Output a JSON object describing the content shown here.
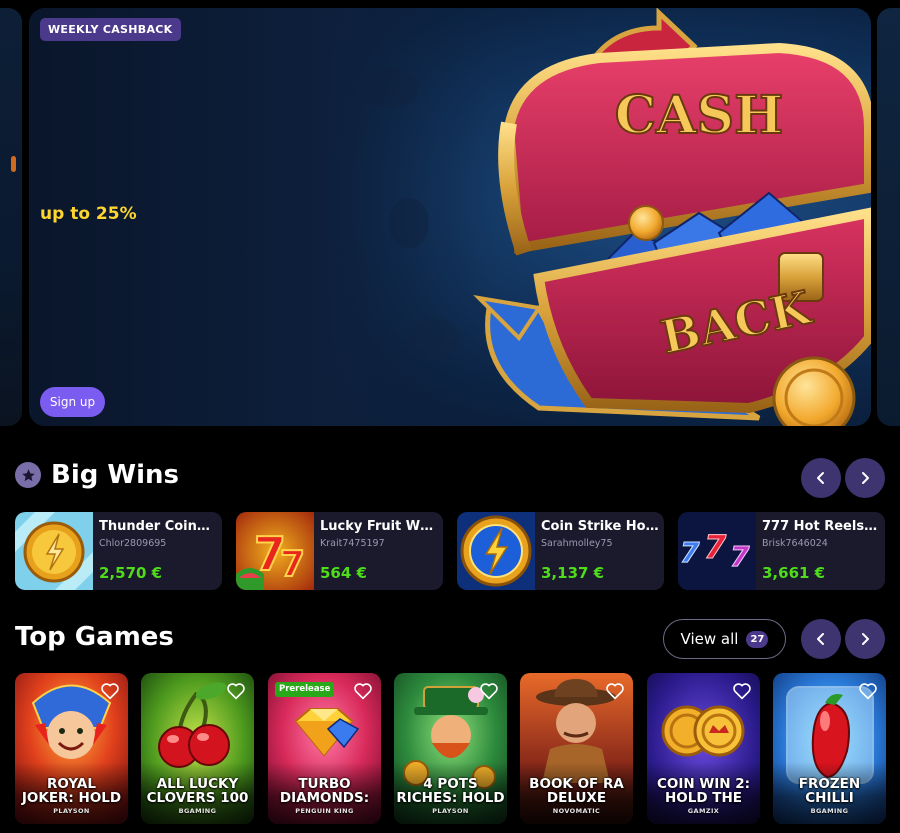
{
  "hero": {
    "tag": "WEEKLY CASHBACK",
    "subtitle": "up to 25%",
    "button": "Sign up",
    "art_text_top": "CASH",
    "art_text_bottom": "BACK"
  },
  "big_wins": {
    "title": "Big Wins",
    "items": [
      {
        "game": "Thunder Coins ...",
        "user": "Chlor2809695",
        "amount": "2,570 €"
      },
      {
        "game": "Lucky Fruit Wh...",
        "user": "Krait7475197",
        "amount": "564 €"
      },
      {
        "game": "Coin Strike Hol...",
        "user": "Sarahmolley75",
        "amount": "3,137 €"
      },
      {
        "game": "777 Hot Reels: S...",
        "user": "Brisk7646024",
        "amount": "3,661 €"
      }
    ]
  },
  "top_games": {
    "title": "Top Games",
    "view_all_label": "View all",
    "view_all_count": "27",
    "items": [
      {
        "name": "ROYAL\nJOKER: HOLD",
        "provider": "PLAYSON",
        "badge": ""
      },
      {
        "name": "ALL LUCKY\nCLOVERS 100",
        "provider": "BGAMING",
        "badge": ""
      },
      {
        "name": "TURBO\nDIAMONDS:",
        "provider": "PENGUIN KING",
        "badge": "Prerelease"
      },
      {
        "name": "4 POTS\nRICHES: HOLD",
        "provider": "PLAYSON",
        "badge": ""
      },
      {
        "name": "BOOK OF RA\nDELUXE",
        "provider": "NOVOMATIC",
        "badge": ""
      },
      {
        "name": "COIN WIN 2:\nHOLD THE",
        "provider": "GAMZIX",
        "badge": ""
      },
      {
        "name": "FROZEN\nCHILLI",
        "provider": "BGAMING",
        "badge": ""
      }
    ]
  },
  "colors": {
    "background": "#000000",
    "accent": "#7a5cf0",
    "card": "#1b1a2c",
    "win_amount": "#4fdc1a",
    "subtitle": "#ffd62e"
  }
}
